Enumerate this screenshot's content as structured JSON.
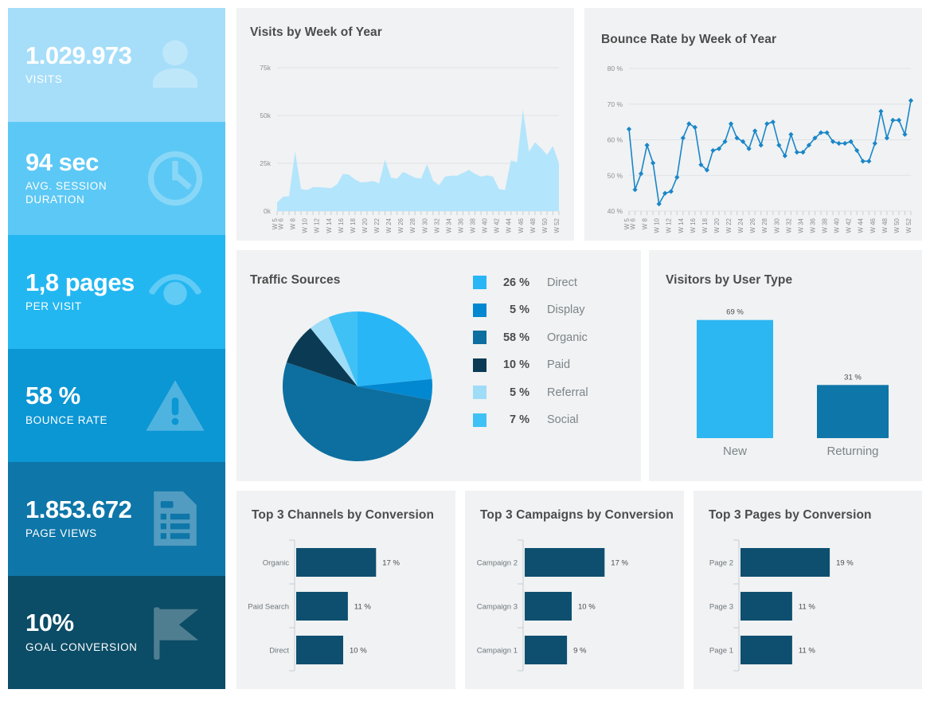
{
  "kpis": [
    {
      "value": "1.029.973",
      "label": "VISITS",
      "bg": "#a6def9",
      "icon": "user-icon"
    },
    {
      "value": "94 sec",
      "label": "AVG. SESSION\nDURATION",
      "bg": "#5cc8f5",
      "icon": "clock-icon"
    },
    {
      "value": "1,8 pages",
      "label": "PER VISIT",
      "bg": "#23b7f2",
      "icon": "eye-icon"
    },
    {
      "value": "58 %",
      "label": "BOUNCE RATE",
      "bg": "#0b96d4",
      "icon": "warning-icon"
    },
    {
      "value": "1.853.672",
      "label": "PAGE VIEWS",
      "bg": "#0e76a8",
      "icon": "document-list-icon"
    },
    {
      "value": "10%",
      "label": "GOAL CONVERSION",
      "bg": "#0b4c66",
      "icon": "flag-icon"
    }
  ],
  "panels": {
    "visits": {
      "title": "Visits by Week of Year"
    },
    "bounce": {
      "title": "Bounce Rate by Week of Year"
    },
    "traffic": {
      "title": "Traffic Sources"
    },
    "usertype": {
      "title": "Visitors by User Type"
    },
    "channels": {
      "title": "Top 3 Channels by Conversion"
    },
    "campaigns": {
      "title": "Top 3 Campaigns by Conversion"
    },
    "pages": {
      "title": "Top 3 Pages by Conversion"
    }
  },
  "colors": {
    "direct": "#29b6f6",
    "display": "#0288d1",
    "organic": "#0d6fa0",
    "paid": "#0b3b54",
    "referral": "#9fdcf7",
    "social": "#3fc1f5",
    "area_fill": "#b3e5fc",
    "line": "#1a86c8",
    "bar_dark": "#0e4f70",
    "bar_new": "#2cb6f2",
    "bar_returning": "#0e76a8",
    "panel_bg": "#f0f2f3",
    "title": "#4c4c4c"
  },
  "chart_data": [
    {
      "type": "area",
      "id": "visits",
      "title": "Visits by Week of Year",
      "xlabel": "",
      "ylabel": "",
      "ylim": [
        0,
        75000
      ],
      "yticks": [
        "0k",
        "25k",
        "50k",
        "75k"
      ],
      "ytickvalues": [
        0,
        25000,
        50000,
        75000
      ],
      "grid": true,
      "categories": [
        "W 5",
        "W 6",
        "W 8",
        "W 10",
        "W 12",
        "W 14",
        "W 16",
        "W 18",
        "W 20",
        "W 22",
        "W 24",
        "W 26",
        "W 28",
        "W 30",
        "W 32",
        "W 34",
        "W 36",
        "W 38",
        "W 40",
        "W 42",
        "W 44",
        "W 46",
        "W 48",
        "W 50",
        "W 52"
      ],
      "x": [
        5,
        6,
        7,
        8,
        9,
        10,
        11,
        12,
        13,
        14,
        15,
        16,
        17,
        18,
        19,
        20,
        21,
        22,
        23,
        24,
        25,
        26,
        27,
        28,
        29,
        30,
        31,
        32,
        33,
        34,
        35,
        36,
        37,
        38,
        39,
        40,
        41,
        42,
        43,
        44,
        45,
        46,
        47,
        48,
        49,
        50,
        51,
        52
      ],
      "values": [
        4500,
        7500,
        7800,
        31000,
        11500,
        11000,
        12500,
        12500,
        12300,
        12000,
        14000,
        19500,
        19000,
        16500,
        15000,
        15200,
        15800,
        14500,
        27000,
        17500,
        17000,
        20500,
        19000,
        17500,
        17000,
        24500,
        16000,
        13500,
        18000,
        18500,
        18500,
        20000,
        21500,
        19500,
        18000,
        18700,
        18000,
        11500,
        11000,
        26500,
        25500,
        53000,
        31000,
        36000,
        33000,
        29500,
        34000,
        25000
      ],
      "legend": false
    },
    {
      "type": "line",
      "id": "bounce",
      "title": "Bounce Rate by Week of Year",
      "xlabel": "",
      "ylabel": "",
      "ylim": [
        40,
        80
      ],
      "yticks": [
        "40 %",
        "50 %",
        "60 %",
        "70 %",
        "80 %"
      ],
      "ytickvalues": [
        40,
        50,
        60,
        70,
        80
      ],
      "grid": true,
      "markers": true,
      "categories": [
        "W 5",
        "W 6",
        "W 8",
        "W 10",
        "W 12",
        "W 14",
        "W 16",
        "W 18",
        "W 20",
        "W 22",
        "W 24",
        "W 26",
        "W 28",
        "W 30",
        "W 32",
        "W 34",
        "W 36",
        "W 38",
        "W 40",
        "W 42",
        "W 44",
        "W 46",
        "W 48",
        "W 50",
        "W 52"
      ],
      "x": [
        5,
        6,
        7,
        8,
        9,
        10,
        11,
        12,
        13,
        14,
        15,
        16,
        17,
        18,
        19,
        20,
        21,
        22,
        23,
        24,
        25,
        26,
        27,
        28,
        29,
        30,
        31,
        32,
        33,
        34,
        35,
        36,
        37,
        38,
        39,
        40,
        41,
        42,
        43,
        44,
        45,
        46,
        47,
        48,
        49,
        50,
        51,
        52
      ],
      "values": [
        63,
        46,
        50.5,
        58.5,
        53.5,
        42,
        45,
        45.5,
        49.5,
        60.5,
        64.5,
        63.5,
        53,
        51.5,
        57,
        57.5,
        59.5,
        64.5,
        60.5,
        59.5,
        57.5,
        62.5,
        58.5,
        64.5,
        65,
        58.5,
        55.5,
        61.5,
        56.5,
        56.5,
        58.5,
        60.5,
        62,
        62,
        59.5,
        59,
        59,
        59.5,
        57,
        54,
        54,
        59,
        68,
        60.5,
        65.5,
        65.5,
        61.5,
        71
      ],
      "legend": false
    },
    {
      "type": "pie",
      "id": "traffic",
      "title": "Traffic Sources",
      "labels": [
        "Direct",
        "Display",
        "Organic",
        "Paid",
        "Referral",
        "Social"
      ],
      "values": [
        26,
        5,
        58,
        10,
        5,
        7
      ],
      "display_values": [
        "26 %",
        "5 %",
        "58 %",
        "10 %",
        "5 %",
        "7 %"
      ],
      "colors": [
        "#29b6f6",
        "#0288d1",
        "#0d6fa0",
        "#0b3b54",
        "#9fdcf7",
        "#3fc1f5"
      ],
      "legend": true,
      "legend_position": "right"
    },
    {
      "type": "bar",
      "id": "usertype",
      "title": "Visitors by User Type",
      "categories": [
        "New",
        "Returning"
      ],
      "values": [
        69,
        31
      ],
      "display_values": [
        "69 %",
        "31 %"
      ],
      "colors": [
        "#2cb6f2",
        "#0e76a8"
      ],
      "ylim": [
        0,
        80
      ],
      "grid": false,
      "legend": false
    },
    {
      "type": "bar",
      "id": "channels",
      "orientation": "horizontal",
      "title": "Top 3 Channels by Conversion",
      "categories": [
        "Organic",
        "Paid Search",
        "Direct"
      ],
      "values": [
        17,
        11,
        10
      ],
      "display_values": [
        "17 %",
        "11 %",
        "10 %"
      ],
      "color": "#0e4f70",
      "xlim": [
        0,
        20
      ],
      "grid": false,
      "legend": false
    },
    {
      "type": "bar",
      "id": "campaigns",
      "orientation": "horizontal",
      "title": "Top 3 Campaigns by Conversion",
      "categories": [
        "Campaign 2",
        "Campaign 3",
        "Campaign 1"
      ],
      "values": [
        17,
        10,
        9
      ],
      "display_values": [
        "17 %",
        "10 %",
        "9 %"
      ],
      "color": "#0e4f70",
      "xlim": [
        0,
        20
      ],
      "grid": false,
      "legend": false
    },
    {
      "type": "bar",
      "id": "pages",
      "orientation": "horizontal",
      "title": "Top 3 Pages by Conversion",
      "categories": [
        "Page 2",
        "Page 3",
        "Page 1"
      ],
      "values": [
        19,
        11,
        11
      ],
      "display_values": [
        "19 %",
        "11 %",
        "11 %"
      ],
      "color": "#0e4f70",
      "xlim": [
        0,
        20
      ],
      "grid": false,
      "legend": false
    }
  ]
}
